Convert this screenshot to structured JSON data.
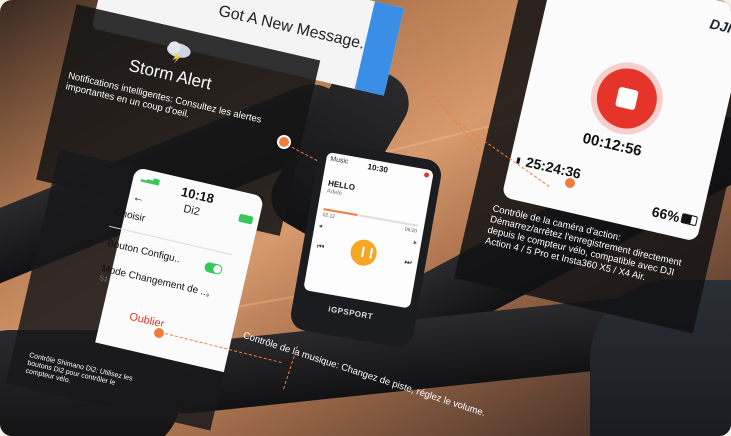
{
  "notification": {
    "top_message": "Got A New Message.",
    "title": "Storm Alert",
    "caption": "Notifications intelligentes: Consultez les alertes importantes en un coup d'oeil."
  },
  "shimano_phone": {
    "time": "10:18",
    "back_glyph": "←",
    "screen_title": "Di2",
    "rows": [
      {
        "label": "Choisir",
        "value": ""
      },
      {
        "label": "Bouton Configu..",
        "value": ""
      },
      {
        "label": "Mode Changement de ...",
        "value": "S1"
      }
    ],
    "action": "Oublier",
    "caption": "Contrôle Shimano Di2: Utilisez les boutons Di2 pour contrôler le compteur vélo."
  },
  "bike_computer": {
    "time": "10:30",
    "app_label": "Music",
    "track_title": "HELLO",
    "track_artist": "Adele",
    "elapsed": "02:12",
    "duration": "06:20",
    "brand": "iGPSPORT",
    "caption": "Contrôle de la musique: Changez de piste, réglez le volume."
  },
  "camera_phone": {
    "logo": "DJI",
    "rec_time": "00:12:56",
    "remaining": "25:24:36",
    "battery": "66%",
    "caption": "Contrôle de la caméra d'action: Démarrez/arrêtez l'enregistrement directement depuis le compteur vélo, compatible avec DJI Action 4 / 5 Pro et Insta360 X5 / X4 Air."
  },
  "colors": {
    "accent": "#f37b3e",
    "record": "#e5352b",
    "toggle": "#37c65a",
    "blue": "#3a8ee6"
  }
}
